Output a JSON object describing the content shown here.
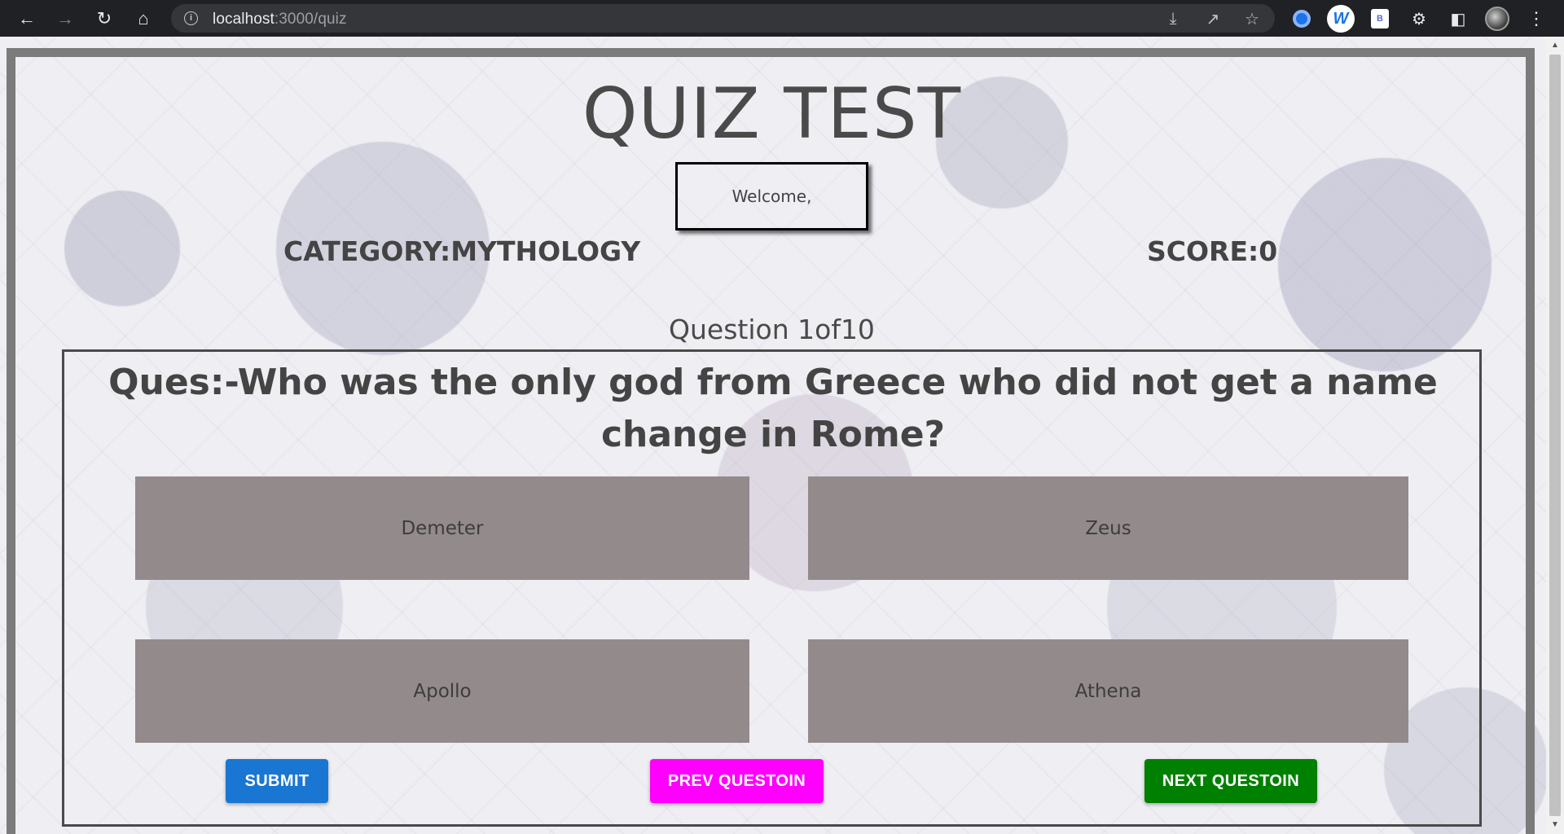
{
  "browser": {
    "url_host": "localhost",
    "url_path": ":3000/quiz"
  },
  "quiz": {
    "title": "QUIZ TEST",
    "welcome": "Welcome,",
    "category": "CATEGORY:MYTHOLOGY",
    "score": "SCORE:0",
    "counter": "Question 1of10",
    "question": "Ques:-Who was the only god from Greece who did not get a name change in Rome?",
    "options": [
      "Demeter",
      "Zeus",
      "Apollo",
      "Athena"
    ],
    "buttons": {
      "submit": "SUBMIT",
      "prev": "PREV QUESTOIN",
      "next": "NEXT QUESTOIN"
    }
  },
  "colors": {
    "option_bg": "#938a8b",
    "submit": "#1976d2",
    "prev": "#ff00ff",
    "next": "#008000"
  }
}
